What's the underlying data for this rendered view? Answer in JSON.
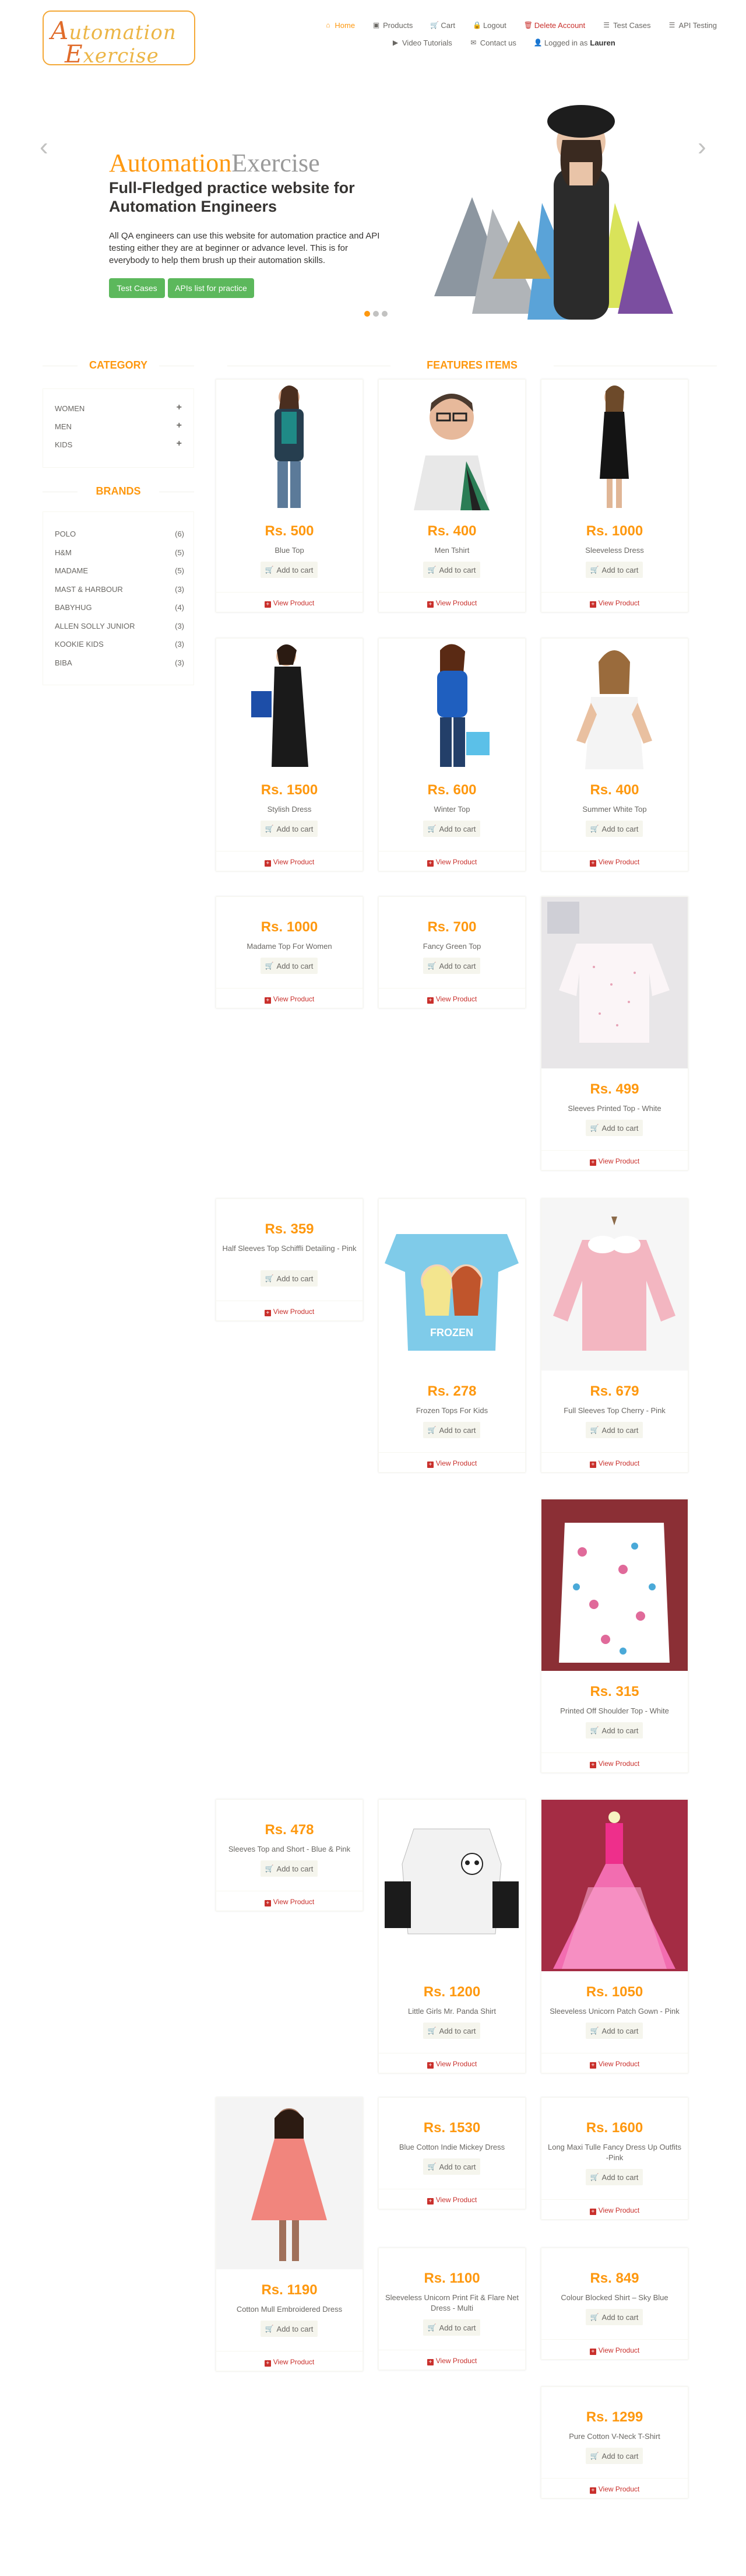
{
  "logo": {
    "line1_cap": "A",
    "line1_rest": "utomation",
    "line2_cap": "E",
    "line2_rest": "xercise"
  },
  "nav": [
    {
      "icon": "home-icon",
      "glyph": "⌂",
      "label": "Home",
      "active": true
    },
    {
      "icon": "products-icon",
      "glyph": "▣",
      "label": "Products"
    },
    {
      "icon": "cart-icon",
      "glyph": "🛒",
      "label": "Cart"
    },
    {
      "icon": "lock-icon",
      "glyph": "🔒",
      "label": "Logout"
    },
    {
      "icon": "trash-icon",
      "glyph": "🗑",
      "label": "Delete Account",
      "red": true
    },
    {
      "icon": "list-icon",
      "glyph": "☰",
      "label": "Test Cases"
    },
    {
      "icon": "list-icon",
      "glyph": "☰",
      "label": "API Testing"
    },
    {
      "icon": "youtube-icon",
      "glyph": "▶",
      "label": "Video Tutorials"
    },
    {
      "icon": "envelope-icon",
      "glyph": "✉",
      "label": "Contact us"
    },
    {
      "icon": "user-icon",
      "glyph": "👤",
      "label": "Logged in as",
      "user": "Lauren"
    }
  ],
  "slider": {
    "brand_a": "Automation",
    "brand_b": "Exercise",
    "heading": "Full-Fledged practice website for Automation Engineers",
    "text": "All QA engineers can use this website for automation practice and API testing either they are at beginner or advance level. This is for everybody to help them brush up their automation skills.",
    "btn_test_cases": "Test Cases",
    "btn_apis": "APIs list for practice",
    "prev": "‹",
    "next": "›"
  },
  "sidebar": {
    "category_title": "CATEGORY",
    "categories": [
      "Women",
      "Men",
      "Kids"
    ],
    "brands_title": "BRANDS",
    "brands": [
      {
        "name": "Polo",
        "count": "(6)"
      },
      {
        "name": "H&M",
        "count": "(5)"
      },
      {
        "name": "Madame",
        "count": "(5)"
      },
      {
        "name": "Mast & Harbour",
        "count": "(3)"
      },
      {
        "name": "Babyhug",
        "count": "(4)"
      },
      {
        "name": "Allen Solly Junior",
        "count": "(3)"
      },
      {
        "name": "Kookie Kids",
        "count": "(3)"
      },
      {
        "name": "Biba",
        "count": "(3)"
      }
    ]
  },
  "features_title": "FEATURES ITEMS",
  "labels": {
    "add_to_cart": "Add to cart",
    "view_product": "View Product"
  },
  "products": [
    {
      "price": "Rs. 500",
      "name": "Blue Top"
    },
    {
      "price": "Rs. 400",
      "name": "Men Tshirt"
    },
    {
      "price": "Rs. 1000",
      "name": "Sleeveless Dress"
    },
    {
      "price": "Rs. 1500",
      "name": "Stylish Dress"
    },
    {
      "price": "Rs. 600",
      "name": "Winter Top"
    },
    {
      "price": "Rs. 400",
      "name": "Summer White Top"
    },
    {
      "price": "Rs. 1000",
      "name": "Madame Top For Women"
    },
    {
      "price": "Rs. 700",
      "name": "Fancy Green Top"
    },
    {
      "price": "Rs. 499",
      "name": "Sleeves Printed Top - White"
    },
    {
      "price": "Rs. 359",
      "name": "Half Sleeves Top Schiffli Detailing - Pink"
    },
    {
      "price": "Rs. 278",
      "name": "Frozen Tops For Kids"
    },
    {
      "price": "Rs. 679",
      "name": "Full Sleeves Top Cherry - Pink"
    },
    {
      "price": "Rs. 315",
      "name": "Printed Off Shoulder Top - White"
    },
    {
      "price": "Rs. 478",
      "name": "Sleeves Top and Short - Blue & Pink"
    },
    {
      "price": "Rs. 1200",
      "name": "Little Girls Mr. Panda Shirt"
    },
    {
      "price": "Rs. 1050",
      "name": "Sleeveless Unicorn Patch Gown - Pink"
    },
    {
      "price": "Rs. 1530",
      "name": "Blue Cotton Indie Mickey Dress"
    },
    {
      "price": "Rs. 1600",
      "name": "Long Maxi Tulle Fancy Dress Up Outfits -Pink"
    },
    {
      "price": "Rs. 1190",
      "name": "Cotton Mull Embroidered Dress"
    },
    {
      "price": "Rs. 1100",
      "name": "Sleeveless Unicorn Print Fit & Flare Net Dress - Multi"
    },
    {
      "price": "Rs. 849",
      "name": "Colour Blocked Shirt – Sky Blue"
    },
    {
      "price": "Rs. 1299",
      "name": "Pure Cotton V-Neck T-Shirt"
    }
  ]
}
